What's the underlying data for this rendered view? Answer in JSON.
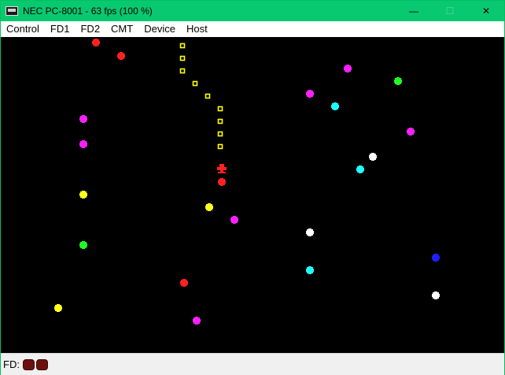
{
  "window": {
    "title": "NEC PC-8001 - 63 fps (100 %)",
    "icons": {
      "app": "pc-monitor-icon",
      "minimize": "minimize-icon",
      "maximize": "maximize-icon",
      "close": "close-icon"
    },
    "titlebar_color": "#08c870"
  },
  "menu": [
    "Control",
    "FD1",
    "FD2",
    "CMT",
    "Device",
    "Host"
  ],
  "game": {
    "background": "#000000",
    "player": {
      "color": "#ff2020",
      "icon": "player-ship-icon"
    },
    "trail_color": "#ffff00",
    "star_colors": [
      "#ff2020",
      "#ff20ff",
      "#20ff20",
      "#20ffff",
      "#ffff20",
      "#ffffff",
      "#2020ff"
    ]
  },
  "status": {
    "fd_label": "FD:",
    "fd_leds": [
      {
        "name": "fd1-led",
        "state": "off",
        "color": "#6e0f0f"
      },
      {
        "name": "fd2-led",
        "state": "off",
        "color": "#6e0f0f"
      }
    ]
  }
}
